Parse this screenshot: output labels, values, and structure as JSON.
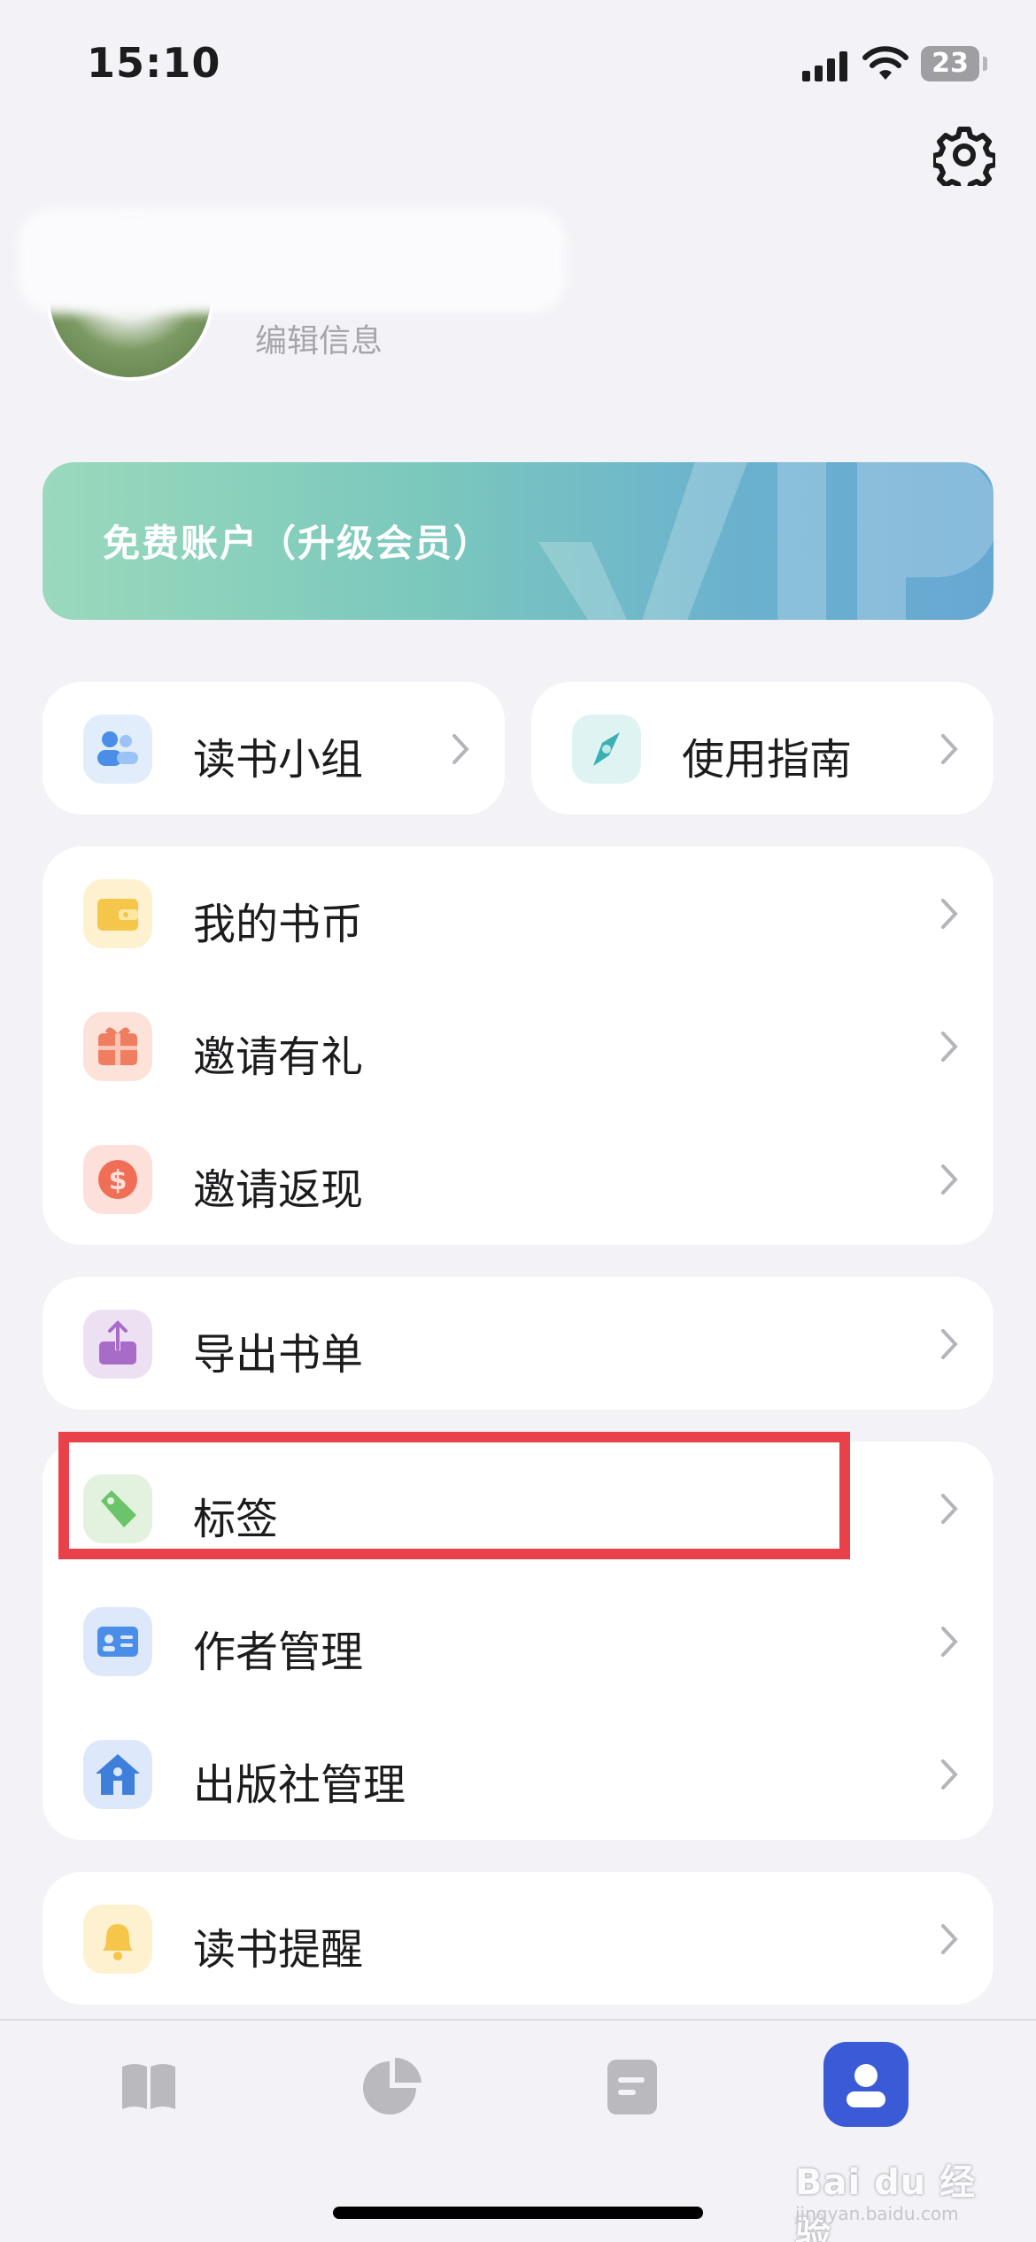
{
  "status_bar": {
    "time": "15:10",
    "battery": "23"
  },
  "profile": {
    "edit_label": "编辑信息"
  },
  "vip": {
    "label": "免费账户（升级会员）"
  },
  "quick_links": [
    {
      "label": "读书小组",
      "icon": "group-icon"
    },
    {
      "label": "使用指南",
      "icon": "compass-icon"
    }
  ],
  "account_menu": [
    {
      "label": "我的书币",
      "icon": "wallet-icon"
    },
    {
      "label": "邀请有礼",
      "icon": "gift-icon"
    },
    {
      "label": "邀请返现",
      "icon": "dollar-icon"
    }
  ],
  "export_menu": [
    {
      "label": "导出书单",
      "icon": "export-icon"
    }
  ],
  "manage_menu": [
    {
      "label": "标签",
      "icon": "tag-icon"
    },
    {
      "label": "作者管理",
      "icon": "id-card-icon"
    },
    {
      "label": "出版社管理",
      "icon": "publisher-house-icon"
    }
  ],
  "reminder_menu": [
    {
      "label": "读书提醒",
      "icon": "bell-icon"
    }
  ],
  "tab_bar": [
    "bookshelf-icon",
    "stats-icon",
    "notes-icon",
    "profile-icon"
  ],
  "watermark": {
    "text": "Bai du 经验",
    "sub": "jingyan.baidu.com"
  },
  "colors": {
    "accent": "#3b5bd6",
    "highlight": "#e8414a"
  }
}
